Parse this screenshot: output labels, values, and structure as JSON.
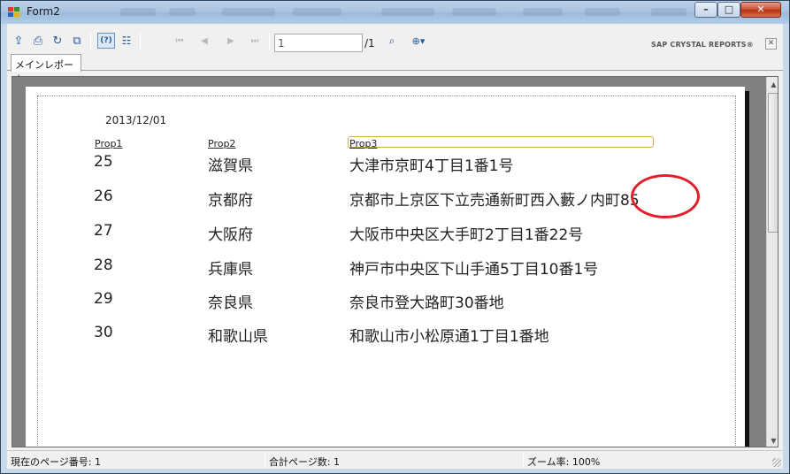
{
  "window": {
    "title": "Form2"
  },
  "colors": {
    "titlebar": "#a7c2e1",
    "annotation_circle": "#e0202a",
    "header_box": "#d9a84a"
  },
  "toolbar": {
    "icons": [
      "export-icon",
      "print-icon",
      "refresh-icon",
      "copy-icon",
      "help-icon",
      "group-tree-icon",
      "first-page-icon",
      "previous-page-icon",
      "next-page-icon",
      "last-page-icon",
      "find-icon",
      "zoom-icon"
    ],
    "page_input_value": "1",
    "page_total": "/1",
    "brand": "SAP CRYSTAL REPORTS®",
    "close_glyph": "✕"
  },
  "tabs": {
    "main": "メインレポート"
  },
  "report": {
    "date": "2013/12/01",
    "headers": [
      "Prop1",
      "Prop2",
      "Prop3"
    ],
    "rows": [
      {
        "prop1": "25",
        "prop2": "滋賀県",
        "prop3": "大津市京町4丁目1番1号"
      },
      {
        "prop1": "26",
        "prop2": "京都府",
        "prop3": "京都市上京区下立売通新町西入藪ノ内町85"
      },
      {
        "prop1": "27",
        "prop2": "大阪府",
        "prop3": "大阪市中央区大手町2丁目1番22号"
      },
      {
        "prop1": "28",
        "prop2": "兵庫県",
        "prop3": "神戸市中央区下山手通5丁目10番1号"
      },
      {
        "prop1": "29",
        "prop2": "奈良県",
        "prop3": "奈良市登大路町30番地"
      },
      {
        "prop1": "30",
        "prop2": "和歌山県",
        "prop3": "和歌山市小松原通1丁目1番地"
      }
    ]
  },
  "status": {
    "current_page": "現在のページ番号: 1",
    "total_pages": "合計ページ数: 1",
    "zoom": "ズーム率: 100%"
  }
}
